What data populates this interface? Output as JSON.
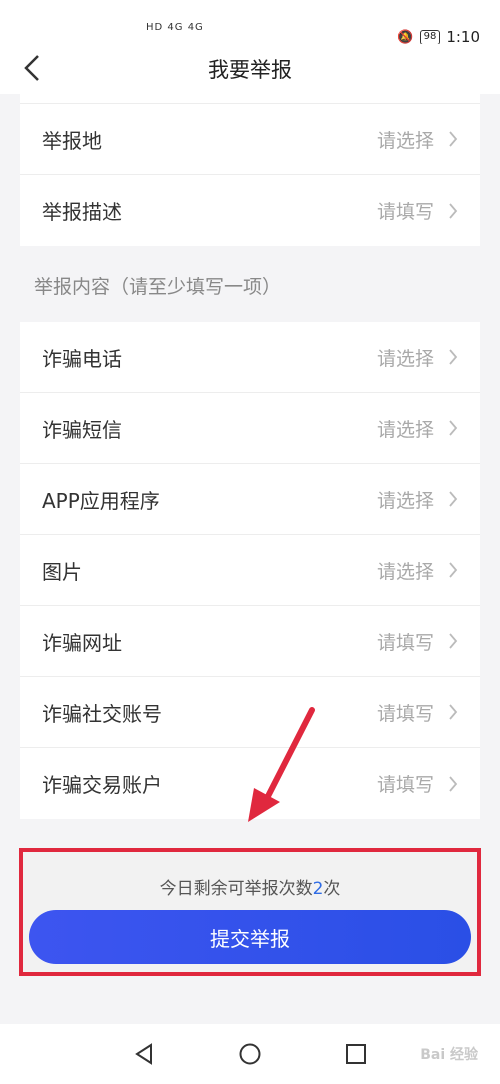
{
  "status_bar": {
    "left_indicators": "HD 4G 4G",
    "battery": "98",
    "time": "1:10"
  },
  "header": {
    "title": "我要举报"
  },
  "top_rows": [
    {
      "label": "举报地",
      "value": "请选择"
    },
    {
      "label": "举报描述",
      "value": "请填写"
    }
  ],
  "section": {
    "title": "举报内容（请至少填写一项）"
  },
  "content_rows": [
    {
      "label": "诈骗电话",
      "value": "请选择"
    },
    {
      "label": "诈骗短信",
      "value": "请选择"
    },
    {
      "label": "APP应用程序",
      "value": "请选择"
    },
    {
      "label": "图片",
      "value": "请选择"
    },
    {
      "label": "诈骗网址",
      "value": "请填写"
    },
    {
      "label": "诈骗社交账号",
      "value": "请填写"
    },
    {
      "label": "诈骗交易账户",
      "value": "请填写"
    }
  ],
  "footer": {
    "quota_prefix": "今日剩余可举报次数",
    "quota_count": "2",
    "quota_suffix": "次",
    "submit_label": "提交举报"
  },
  "watermark": "Bai 经验",
  "colors": {
    "accent": "#2f6ce5",
    "highlight": "#e0283e",
    "button": "#3d55f0"
  },
  "icons": {
    "back": "back-chevron-icon",
    "row_arrow": "chevron-right-icon",
    "nav_back": "triangle-back-icon",
    "nav_home": "circle-home-icon",
    "nav_recent": "square-recent-icon",
    "annotation": "red-arrow-icon"
  }
}
